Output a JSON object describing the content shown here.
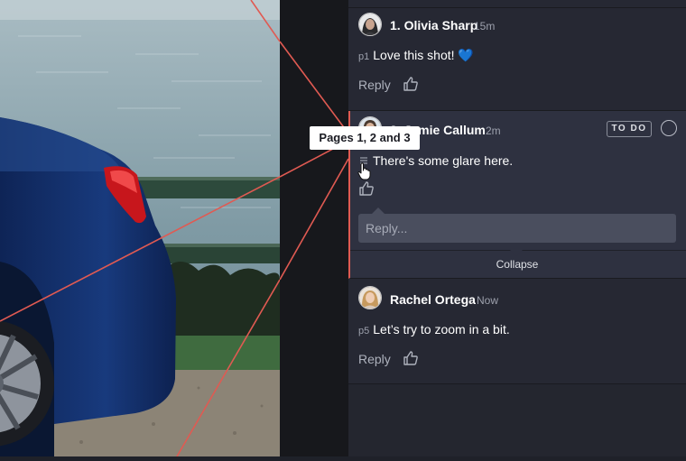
{
  "comments": [
    {
      "author": "1. Olivia Sharp",
      "time": "15m",
      "page_tag": "p1",
      "text": "Love this shot! 💙",
      "reply_label": "Reply"
    },
    {
      "author": "2. Jamie Callum",
      "time": "2m",
      "text": "There's some glare here.",
      "status": "TO DO",
      "reply_placeholder": "Reply...",
      "collapse_label": "Collapse",
      "expanded": true
    },
    {
      "author": "Rachel Ortega",
      "time": "Now",
      "page_tag": "p5",
      "text": "Let’s try to zoom in a bit.",
      "reply_label": "Reply"
    }
  ],
  "tooltip": "Pages 1, 2 and 3",
  "icons": {
    "like": "thumbs-up-icon",
    "pages": "stacked-pages-icon",
    "status": "circle-check-icon",
    "cursor": "hand-pointer-icon"
  },
  "colors": {
    "accent": "#e05a52",
    "panel": "#262833",
    "active_comment": "#2e3140",
    "input": "#4a4e5e"
  }
}
